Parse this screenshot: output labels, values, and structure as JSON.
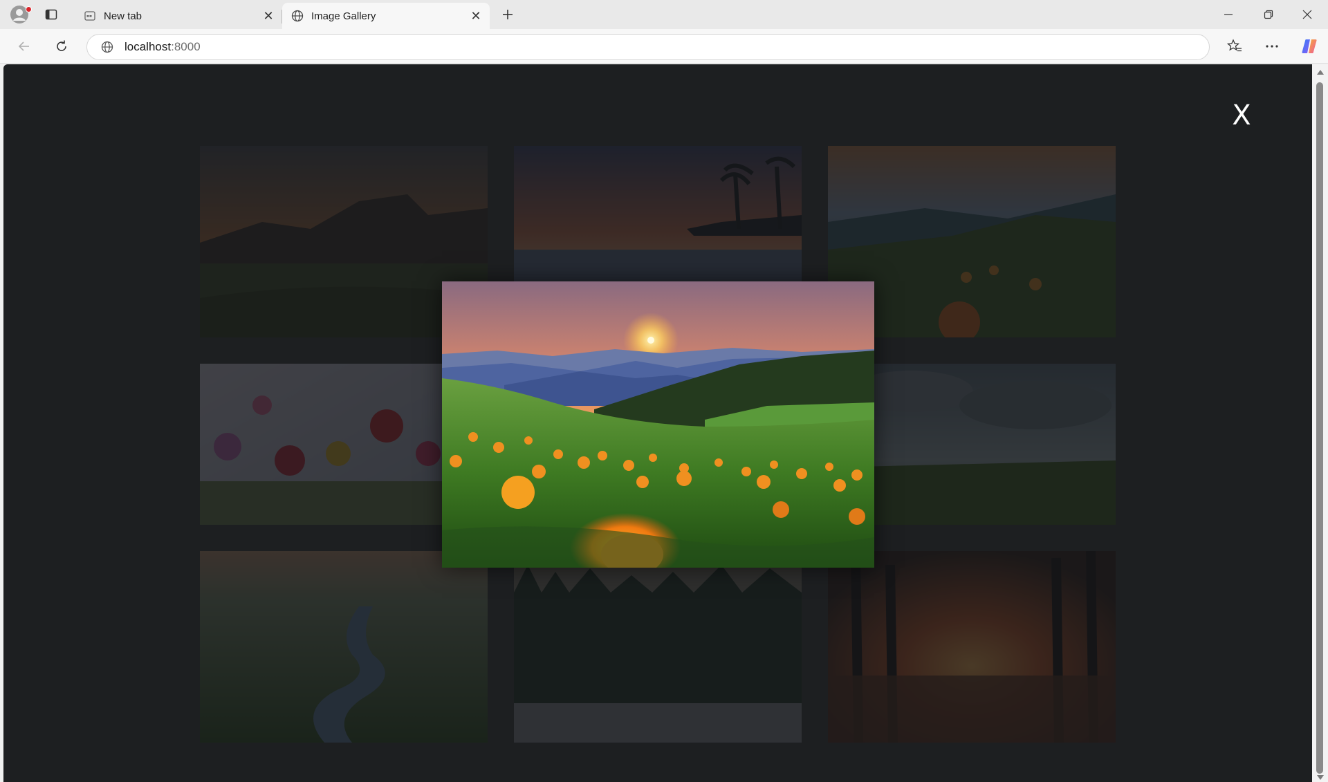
{
  "browser": {
    "tabs": [
      {
        "label": "New tab",
        "active": false
      },
      {
        "label": "Image Gallery",
        "active": true
      }
    ],
    "address": {
      "host": "localhost",
      "port": ":8000"
    }
  },
  "icons": {
    "profile": "profile-avatar-icon",
    "tabs": "vertical-tabs-icon",
    "newtab": "plus-icon",
    "back": "back-arrow-icon",
    "refresh": "refresh-icon",
    "site": "globe-icon",
    "favorites": "star-list-icon",
    "more": "more-dots-icon",
    "copilot": "copilot-icon"
  },
  "gallery": {
    "close_label": "X",
    "thumbnails": [
      {
        "name": "mountain-sunset-meadow"
      },
      {
        "name": "palm-beach-sunset"
      },
      {
        "name": "hills-wildflowers"
      },
      {
        "name": "colorful-flowers"
      },
      {
        "name": "cloudy-meadow"
      },
      {
        "name": "river-valley"
      },
      {
        "name": "forest-path"
      },
      {
        "name": "forest-lake-sunset"
      }
    ],
    "selected": "mountain-meadow-flowers-sunset"
  },
  "colors": {
    "page_background": "#1d1f21",
    "close_text": "#ffffff"
  }
}
